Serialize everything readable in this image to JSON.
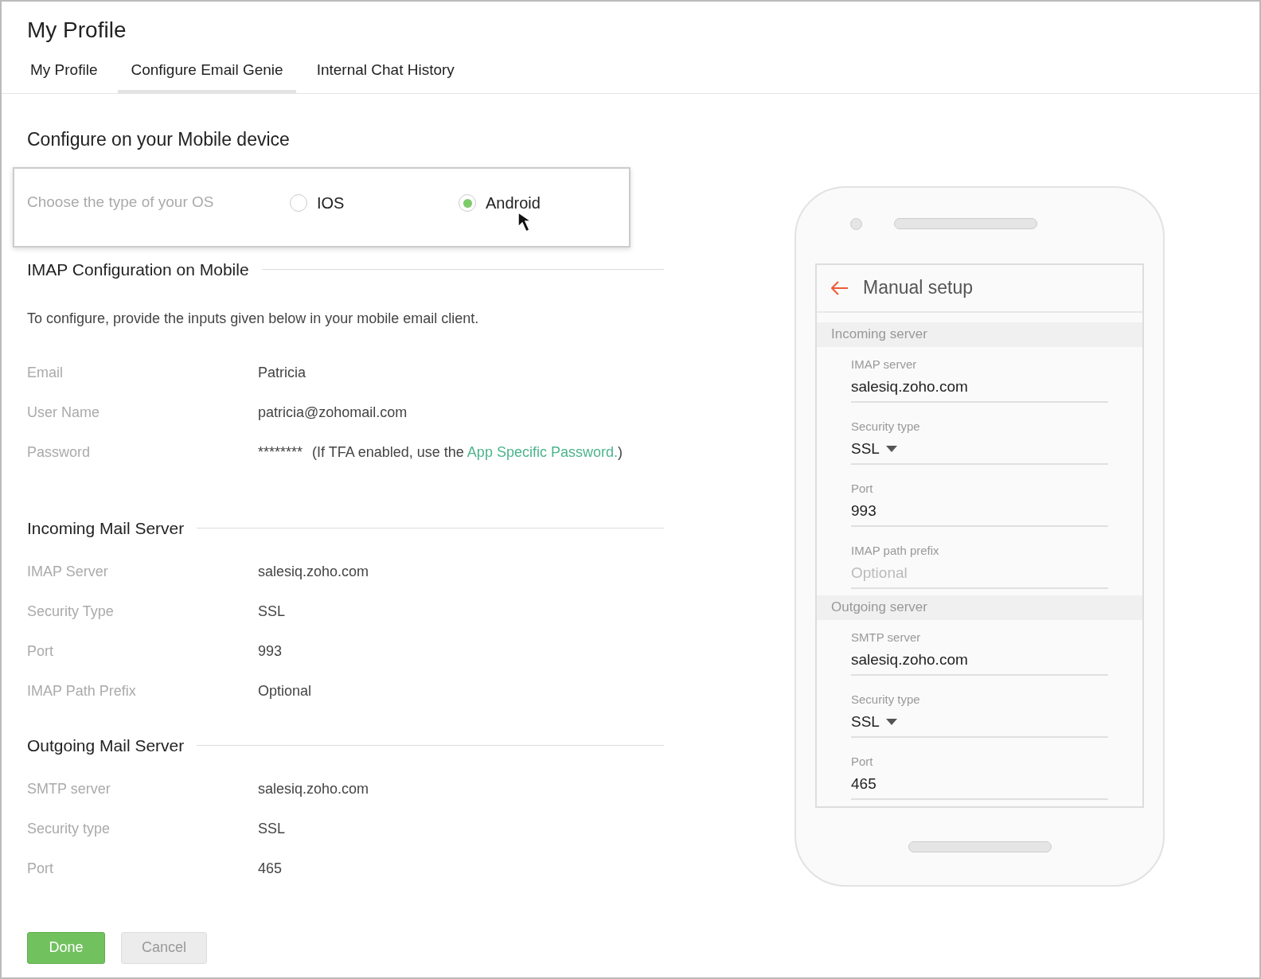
{
  "page_title": "My Profile",
  "tabs": [
    {
      "label": "My Profile",
      "selected": false
    },
    {
      "label": "Configure Email Genie",
      "selected": true
    },
    {
      "label": "Internal Chat History",
      "selected": false
    }
  ],
  "section_title": "Configure on your Mobile device",
  "os_choice": {
    "label": "Choose the type of your OS",
    "options": [
      {
        "label": "IOS",
        "selected": false
      },
      {
        "label": "Android",
        "selected": true
      }
    ]
  },
  "imap": {
    "title": "IMAP Configuration on Mobile",
    "intro": "To configure, provide the inputs given below in your mobile email client.",
    "fields": [
      {
        "label": "Email",
        "value": "Patricia"
      },
      {
        "label": "User Name",
        "value": "patricia@zohomail.com"
      },
      {
        "label": "Password",
        "value": "********",
        "note": "(If TFA enabled, use the ",
        "link": "App Specific Password.",
        "note_end": ")"
      }
    ]
  },
  "incoming": {
    "title": "Incoming Mail Server",
    "fields": [
      {
        "label": "IMAP Server",
        "value": "salesiq.zoho.com"
      },
      {
        "label": "Security Type",
        "value": "SSL"
      },
      {
        "label": "Port",
        "value": "993"
      },
      {
        "label": "IMAP Path Prefix",
        "value": "Optional"
      }
    ]
  },
  "outgoing": {
    "title": "Outgoing Mail Server",
    "fields": [
      {
        "label": "SMTP server",
        "value": "salesiq.zoho.com"
      },
      {
        "label": "Security type",
        "value": "SSL"
      },
      {
        "label": "Port",
        "value": "465"
      }
    ]
  },
  "phone": {
    "title": "Manual setup",
    "sections": [
      {
        "header": "Incoming server",
        "fields": [
          {
            "label": "IMAP server",
            "value": "salesiq.zoho.com",
            "kind": "text"
          },
          {
            "label": "Security type",
            "value": "SSL",
            "kind": "select"
          },
          {
            "label": "Port",
            "value": "993",
            "kind": "text"
          },
          {
            "label": "IMAP path prefix",
            "placeholder": "Optional",
            "kind": "placeholder"
          }
        ]
      },
      {
        "header": "Outgoing server",
        "fields": [
          {
            "label": "SMTP server",
            "value": "salesiq.zoho.com",
            "kind": "text"
          },
          {
            "label": "Security type",
            "value": "SSL",
            "kind": "select"
          },
          {
            "label": "Port",
            "value": "465",
            "kind": "text"
          }
        ]
      }
    ]
  },
  "buttons": [
    {
      "label": "Done",
      "kind": "primary"
    },
    {
      "label": "Cancel",
      "kind": "secondary"
    }
  ]
}
